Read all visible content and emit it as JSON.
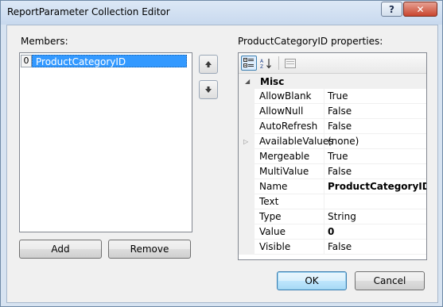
{
  "window": {
    "title": "ReportParameter Collection Editor",
    "help_glyph": "?",
    "close_glyph": "✕"
  },
  "members": {
    "label": "Members:",
    "items": [
      {
        "index": "0",
        "value": "ProductCategoryID",
        "selected": true
      }
    ],
    "move_up_icon": "arrow-up",
    "move_down_icon": "arrow-down",
    "add_label": "Add",
    "remove_label": "Remove"
  },
  "properties": {
    "label": "ProductCategoryID properties:",
    "toolbar": [
      {
        "icon": "categorized-icon",
        "active": true
      },
      {
        "icon": "alphabetical-icon",
        "active": false
      },
      {
        "icon": "property-pages-icon",
        "active": false
      }
    ],
    "category": "Misc",
    "rows": [
      {
        "name": "AllowBlank",
        "value": "True",
        "bold": false,
        "expandable": false
      },
      {
        "name": "AllowNull",
        "value": "False",
        "bold": false,
        "expandable": false
      },
      {
        "name": "AutoRefresh",
        "value": "False",
        "bold": false,
        "expandable": false
      },
      {
        "name": "AvailableValues",
        "value": "(none)",
        "bold": false,
        "expandable": true
      },
      {
        "name": "Mergeable",
        "value": "True",
        "bold": false,
        "expandable": false
      },
      {
        "name": "MultiValue",
        "value": "False",
        "bold": false,
        "expandable": false
      },
      {
        "name": "Name",
        "value": "ProductCategoryID",
        "bold": true,
        "expandable": false
      },
      {
        "name": "Text",
        "value": "",
        "bold": false,
        "expandable": false
      },
      {
        "name": "Type",
        "value": "String",
        "bold": false,
        "expandable": false
      },
      {
        "name": "Value",
        "value": "0",
        "bold": true,
        "expandable": false
      },
      {
        "name": "Visible",
        "value": "False",
        "bold": false,
        "expandable": false
      }
    ]
  },
  "footer": {
    "ok_label": "OK",
    "cancel_label": "Cancel"
  }
}
